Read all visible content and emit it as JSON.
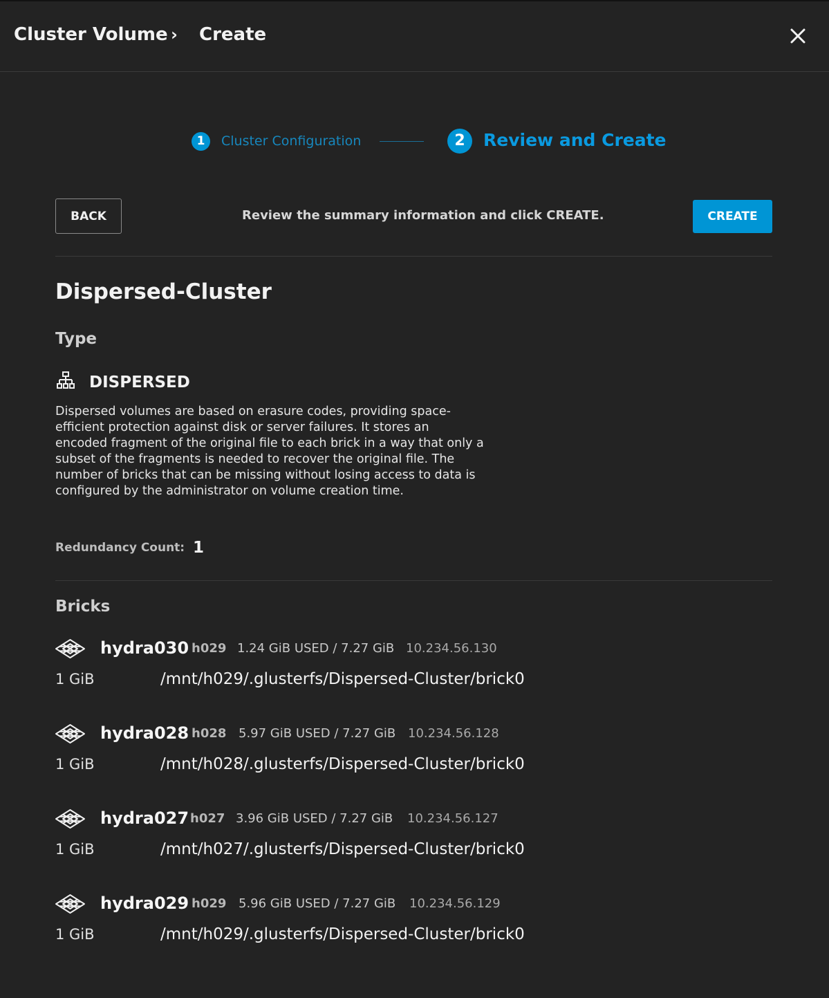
{
  "header": {
    "breadcrumb": [
      "Cluster Volume",
      "Create"
    ],
    "separator": "›",
    "close_icon": "close-icon"
  },
  "stepper": {
    "steps": [
      {
        "number": "1",
        "label": "Cluster Configuration",
        "state": "completed"
      },
      {
        "number": "2",
        "label": "Review and Create",
        "state": "active"
      }
    ]
  },
  "toolbar": {
    "back_label": "BACK",
    "summary_text": "Review the summary information and click CREATE.",
    "create_label": "CREATE"
  },
  "cluster": {
    "name": "Dispersed-Cluster",
    "type_heading": "Type",
    "type_name": "DISPERSED",
    "type_icon": "network-hierarchy-icon",
    "type_description": "Dispersed volumes are based on erasure codes, providing space-efficient protection against disk or server failures. It stores an encoded fragment of the original file to each brick in a way that only a subset of the fragments is needed to recover the original file. The number of bricks that can be missing without losing access to data is configured by the administrator on volume creation time.",
    "redundancy_label": "Redundancy Count:",
    "redundancy_value": "1"
  },
  "bricks": {
    "heading": "Bricks",
    "host_icon": "server-node-icon",
    "items": [
      {
        "host": "hydra030",
        "short": "h029",
        "usage": "1.24 GiB USED / 7.27 GiB",
        "ip": "10.234.56.130",
        "size": "1 GiB",
        "path": "/mnt/h029/.glusterfs/Dispersed-Cluster/brick0"
      },
      {
        "host": "hydra028",
        "short": "h028",
        "usage": "5.97 GiB USED / 7.27 GiB",
        "ip": "10.234.56.128",
        "size": "1 GiB",
        "path": "/mnt/h028/.glusterfs/Dispersed-Cluster/brick0"
      },
      {
        "host": "hydra027",
        "short": "h027",
        "usage": "3.96 GiB USED / 7.27 GiB",
        "ip": "10.234.56.127",
        "size": "1 GiB",
        "path": "/mnt/h027/.glusterfs/Dispersed-Cluster/brick0"
      },
      {
        "host": "hydra029",
        "short": "h029",
        "usage": "5.96 GiB USED / 7.27 GiB",
        "ip": "10.234.56.129",
        "size": "1 GiB",
        "path": "/mnt/h029/.glusterfs/Dispersed-Cluster/brick0"
      }
    ]
  },
  "colors": {
    "accent": "#0095d5",
    "background": "#232323",
    "divider": "#3a3a3a"
  }
}
